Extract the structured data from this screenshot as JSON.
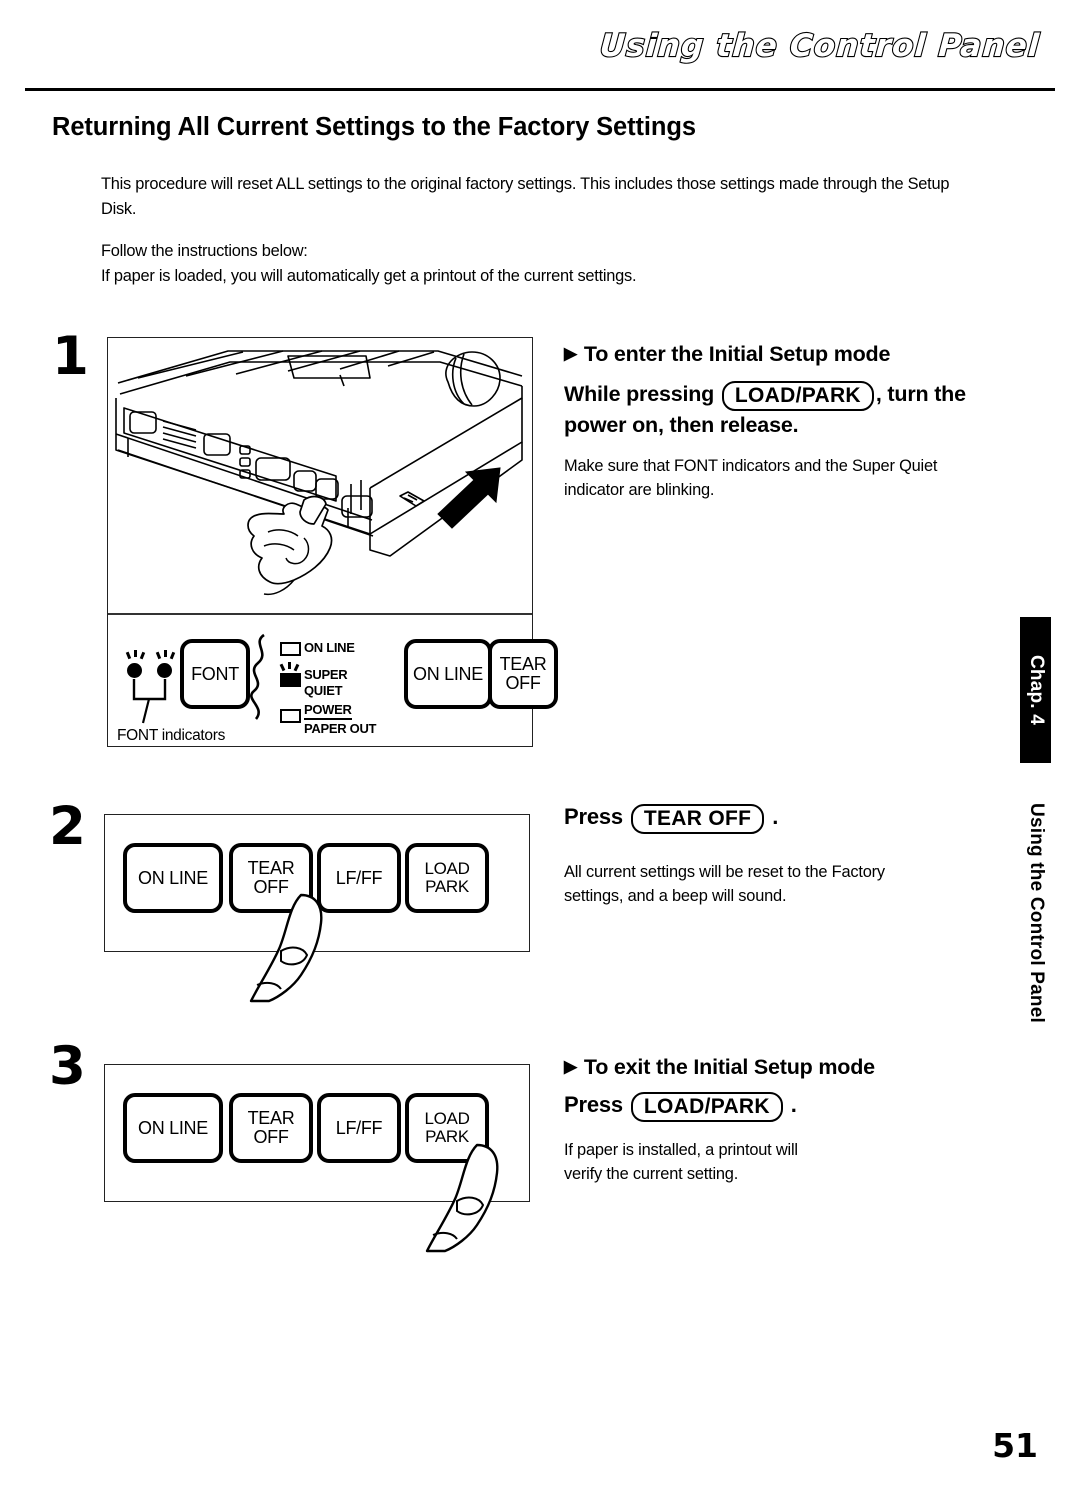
{
  "header": {
    "title": "Using the Control Panel"
  },
  "section": {
    "title": "Returning All Current Settings to the Factory Settings",
    "intro_p1": "This procedure will reset ALL settings to the original factory settings. This includes those settings made through the Setup Disk.",
    "intro_p2_line1": "Follow the instructions below:",
    "intro_p2_line2": "If paper is loaded, you will automatically get a printout of the current settings."
  },
  "steps": [
    {
      "number": "1",
      "heading": "To enter the Initial Setup mode",
      "instruction_before_key": "While pressing",
      "key": "LOAD/PARK",
      "instruction_after_key": ", turn the",
      "instruction_line2": "power on, then release.",
      "body_line1": "Make sure that FONT indicators and the Super Quiet",
      "body_line2": "indicator are blinking."
    },
    {
      "number": "2",
      "press_label": "Press",
      "key": "TEAR OFF",
      "period": ".",
      "body_line1": "All current settings will be reset to the Factory",
      "body_line2": "settings, and a beep will sound."
    },
    {
      "number": "3",
      "heading": "To exit the Initial Setup mode",
      "press_label": "Press",
      "key": "LOAD/PARK",
      "period": ".",
      "body_line1": "If paper is installed, a printout will",
      "body_line2": "verify the current setting."
    }
  ],
  "control_panel": {
    "font_button": "FONT",
    "font_indicators_label": "FONT indicators",
    "indicators": [
      {
        "name": "ON LINE",
        "state": "off"
      },
      {
        "name_line1": "SUPER",
        "name_line2": "QUIET",
        "state": "blinking"
      },
      {
        "name_line1": "POWER",
        "name_line2": "PAPER OUT",
        "state": "off"
      }
    ],
    "buttons_right": [
      {
        "line1": "ON LINE",
        "line2": ""
      },
      {
        "line1": "TEAR",
        "line2": "OFF"
      }
    ]
  },
  "button_row": [
    {
      "line1": "ON LINE",
      "line2": ""
    },
    {
      "line1": "TEAR",
      "line2": "OFF"
    },
    {
      "line1": "LF/FF",
      "line2": ""
    },
    {
      "line1": "LOAD",
      "line2": "PARK"
    }
  ],
  "sidebar": {
    "chapter_tab": "Chap. 4",
    "chapter_title": "Using the Control Panel"
  },
  "page_number": "51"
}
